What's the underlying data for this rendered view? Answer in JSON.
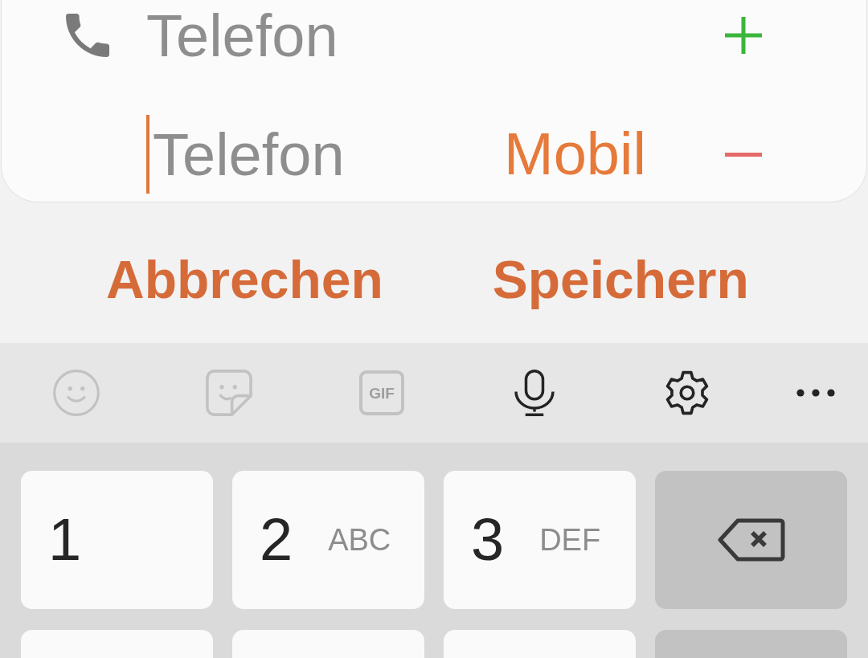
{
  "phone_section": {
    "entries": [
      {
        "placeholder": "Telefon",
        "focused": false,
        "kind": "add"
      },
      {
        "placeholder": "Telefon",
        "focused": true,
        "type": "Mobil",
        "kind": "remove"
      }
    ]
  },
  "dialog_buttons": [
    {
      "label": "Abbrechen"
    },
    {
      "label": "Speichern"
    }
  ],
  "keyboard": {
    "toolbar": [
      {
        "kind": "emoji",
        "disabled": true
      },
      {
        "kind": "sticker",
        "disabled": true
      },
      {
        "kind": "gif",
        "label": "GIF",
        "disabled": true
      },
      {
        "kind": "voice",
        "disabled": false
      },
      {
        "kind": "settings",
        "disabled": false
      },
      {
        "kind": "more",
        "disabled": false
      }
    ],
    "rows": [
      {
        "keys": [
          {
            "kind": "digit",
            "digit": "1"
          },
          {
            "kind": "digit",
            "digit": "2",
            "letters": "ABC"
          },
          {
            "kind": "digit",
            "digit": "3",
            "letters": "DEF"
          },
          {
            "kind": "backspace"
          }
        ]
      },
      {
        "keys": [
          {
            "kind": "digit"
          },
          {
            "kind": "digit"
          },
          {
            "kind": "digit"
          },
          {
            "kind": "function"
          }
        ]
      }
    ]
  }
}
